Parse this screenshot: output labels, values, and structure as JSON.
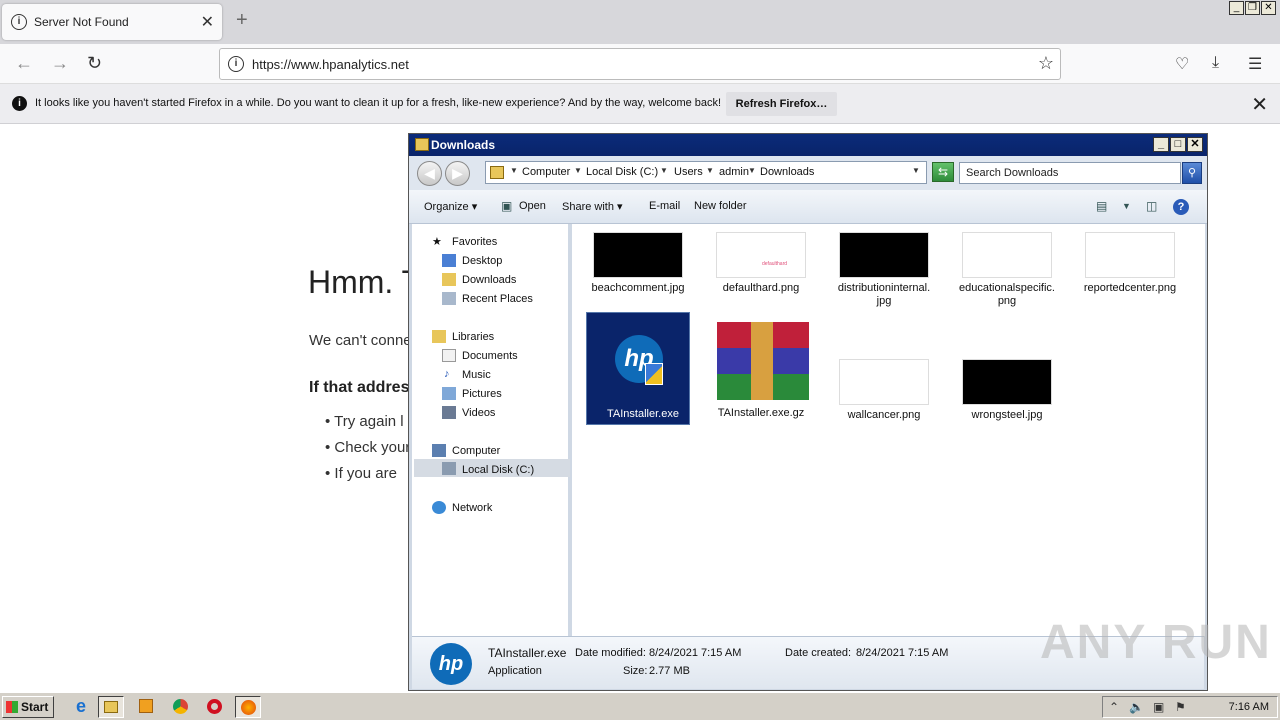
{
  "browser": {
    "tab_title": "Server Not Found",
    "url": "https://www.hpanalytics.net",
    "notification_text": "It looks like you haven't started Firefox in a while. Do you want to clean it up for a fresh, like-new experience? And by the way, welcome back!",
    "notification_button": "Refresh Firefox…"
  },
  "error_page": {
    "title": "Hmm. T",
    "text": "We can't conne",
    "subtitle": "If that addres",
    "items": [
      "Try again l",
      "Check your",
      "If you are"
    ]
  },
  "explorer": {
    "title": "Downloads",
    "breadcrumbs": [
      "Computer",
      "Local Disk (C:)",
      "Users",
      "admin",
      "Downloads"
    ],
    "search_placeholder": "Search Downloads",
    "toolbar": {
      "organize": "Organize",
      "open": "Open",
      "share_with": "Share with",
      "email": "E-mail",
      "new_folder": "New folder"
    },
    "nav": {
      "favorites": "Favorites",
      "desktop": "Desktop",
      "downloads": "Downloads",
      "recent_places": "Recent Places",
      "libraries": "Libraries",
      "documents": "Documents",
      "music": "Music",
      "pictures": "Pictures",
      "videos": "Videos",
      "computer": "Computer",
      "local_disk": "Local Disk (C:)",
      "network": "Network"
    },
    "files": [
      {
        "name": "beachcomment.jpg",
        "thumb_color": "#000000"
      },
      {
        "name": "defaulthard.png",
        "thumb_color": "#ffffff",
        "thumb_text": "defaulthard"
      },
      {
        "name": "distributioninternal.\njpg",
        "thumb_color": "#000000"
      },
      {
        "name": "educationalspecific.\npng",
        "thumb_color": "#ffffff"
      },
      {
        "name": "reportedcenter.png",
        "thumb_color": "#ffffff"
      },
      {
        "name": "TAInstaller.exe",
        "icon": "hp-icon"
      },
      {
        "name": "TAInstaller.exe.gz",
        "icon": "winrar-icon"
      },
      {
        "name": "wallcancer.png",
        "thumb_color": "#ffffff"
      },
      {
        "name": "wrongsteel.jpg",
        "thumb_color": "#000000"
      }
    ],
    "details": {
      "name": "TAInstaller.exe",
      "type": "Application",
      "modified_label": "Date modified:",
      "modified_value": "8/24/2021 7:15 AM",
      "size_label": "Size:",
      "size_value": "2.77 MB",
      "created_label": "Date created:",
      "created_value": "8/24/2021 7:15 AM"
    }
  },
  "watermark": "ANY RUN",
  "taskbar": {
    "start_label": "Start",
    "clock": "7:16 AM"
  }
}
